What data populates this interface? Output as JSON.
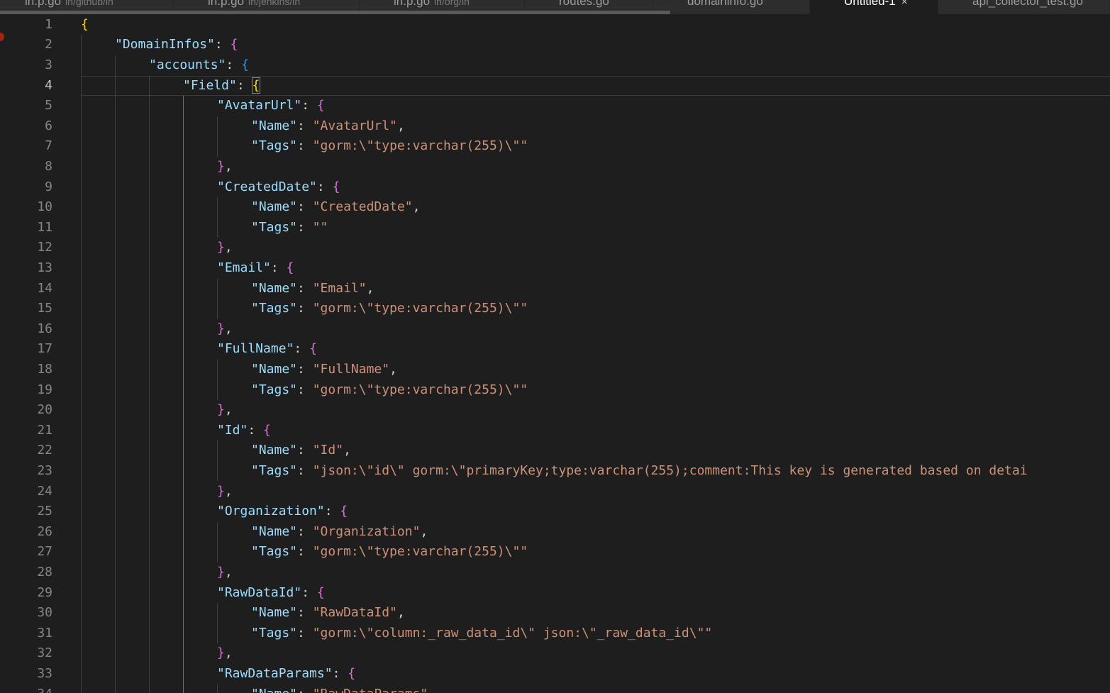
{
  "window": {
    "tabs": [
      {
        "name": "in.p.go",
        "path": "in/github/in",
        "active": false
      },
      {
        "name": "in.p.go",
        "path": "in/jenkins/in",
        "active": false
      },
      {
        "name": "in.p.go",
        "path": "in/org/in",
        "active": false
      },
      {
        "name": "routes.go",
        "path": "",
        "active": false
      },
      {
        "name": "domaininfo.go",
        "path": "",
        "active": false
      },
      {
        "name": "Untitled-1",
        "path": "",
        "active": true,
        "close": "×"
      },
      {
        "name": "api_collector_test.go",
        "path": "",
        "active": false
      }
    ]
  },
  "colors": {
    "background": "#1e1e1e",
    "key": "#9cdcfe",
    "string": "#ce9178",
    "bracket_level_1": "#ffd700",
    "bracket_level_2": "#da70d6",
    "bracket_level_3": "#179fff",
    "breakpoint": "#a1260d"
  },
  "editor": {
    "current_line": 4,
    "lines": [
      {
        "n": 1,
        "indent": 0,
        "tokens": [
          [
            "b1",
            "{"
          ]
        ]
      },
      {
        "n": 2,
        "indent": 1,
        "tokens": [
          [
            "t-key",
            "\"DomainInfos\""
          ],
          [
            "t-p",
            ": "
          ],
          [
            "b2",
            "{"
          ]
        ]
      },
      {
        "n": 3,
        "indent": 2,
        "tokens": [
          [
            "t-key",
            "\"accounts\""
          ],
          [
            "t-p",
            ": "
          ],
          [
            "b3",
            "{"
          ]
        ]
      },
      {
        "n": 4,
        "indent": 3,
        "tokens": [
          [
            "t-key",
            "\"Field\""
          ],
          [
            "t-p",
            ": "
          ],
          [
            "b1 bracket-match",
            "{"
          ]
        ]
      },
      {
        "n": 5,
        "indent": 4,
        "tokens": [
          [
            "t-key",
            "\"AvatarUrl\""
          ],
          [
            "t-p",
            ": "
          ],
          [
            "b2",
            "{"
          ]
        ]
      },
      {
        "n": 6,
        "indent": 5,
        "tokens": [
          [
            "t-key",
            "\"Name\""
          ],
          [
            "t-p",
            ": "
          ],
          [
            "t-str",
            "\"AvatarUrl\""
          ],
          [
            "t-p",
            ","
          ]
        ]
      },
      {
        "n": 7,
        "indent": 5,
        "tokens": [
          [
            "t-key",
            "\"Tags\""
          ],
          [
            "t-p",
            ": "
          ],
          [
            "t-str",
            "\"gorm:\\\"type:varchar(255)\\\"\""
          ]
        ]
      },
      {
        "n": 8,
        "indent": 4,
        "tokens": [
          [
            "b2",
            "}"
          ],
          [
            "t-p",
            ","
          ]
        ]
      },
      {
        "n": 9,
        "indent": 4,
        "tokens": [
          [
            "t-key",
            "\"CreatedDate\""
          ],
          [
            "t-p",
            ": "
          ],
          [
            "b2",
            "{"
          ]
        ]
      },
      {
        "n": 10,
        "indent": 5,
        "tokens": [
          [
            "t-key",
            "\"Name\""
          ],
          [
            "t-p",
            ": "
          ],
          [
            "t-str",
            "\"CreatedDate\""
          ],
          [
            "t-p",
            ","
          ]
        ]
      },
      {
        "n": 11,
        "indent": 5,
        "tokens": [
          [
            "t-key",
            "\"Tags\""
          ],
          [
            "t-p",
            ": "
          ],
          [
            "t-str",
            "\"\""
          ]
        ]
      },
      {
        "n": 12,
        "indent": 4,
        "tokens": [
          [
            "b2",
            "}"
          ],
          [
            "t-p",
            ","
          ]
        ]
      },
      {
        "n": 13,
        "indent": 4,
        "tokens": [
          [
            "t-key",
            "\"Email\""
          ],
          [
            "t-p",
            ": "
          ],
          [
            "b2",
            "{"
          ]
        ]
      },
      {
        "n": 14,
        "indent": 5,
        "tokens": [
          [
            "t-key",
            "\"Name\""
          ],
          [
            "t-p",
            ": "
          ],
          [
            "t-str",
            "\"Email\""
          ],
          [
            "t-p",
            ","
          ]
        ]
      },
      {
        "n": 15,
        "indent": 5,
        "tokens": [
          [
            "t-key",
            "\"Tags\""
          ],
          [
            "t-p",
            ": "
          ],
          [
            "t-str",
            "\"gorm:\\\"type:varchar(255)\\\"\""
          ]
        ]
      },
      {
        "n": 16,
        "indent": 4,
        "tokens": [
          [
            "b2",
            "}"
          ],
          [
            "t-p",
            ","
          ]
        ]
      },
      {
        "n": 17,
        "indent": 4,
        "tokens": [
          [
            "t-key",
            "\"FullName\""
          ],
          [
            "t-p",
            ": "
          ],
          [
            "b2",
            "{"
          ]
        ]
      },
      {
        "n": 18,
        "indent": 5,
        "tokens": [
          [
            "t-key",
            "\"Name\""
          ],
          [
            "t-p",
            ": "
          ],
          [
            "t-str",
            "\"FullName\""
          ],
          [
            "t-p",
            ","
          ]
        ]
      },
      {
        "n": 19,
        "indent": 5,
        "tokens": [
          [
            "t-key",
            "\"Tags\""
          ],
          [
            "t-p",
            ": "
          ],
          [
            "t-str",
            "\"gorm:\\\"type:varchar(255)\\\"\""
          ]
        ]
      },
      {
        "n": 20,
        "indent": 4,
        "tokens": [
          [
            "b2",
            "}"
          ],
          [
            "t-p",
            ","
          ]
        ]
      },
      {
        "n": 21,
        "indent": 4,
        "tokens": [
          [
            "t-key",
            "\"Id\""
          ],
          [
            "t-p",
            ": "
          ],
          [
            "b2",
            "{"
          ]
        ]
      },
      {
        "n": 22,
        "indent": 5,
        "tokens": [
          [
            "t-key",
            "\"Name\""
          ],
          [
            "t-p",
            ": "
          ],
          [
            "t-str",
            "\"Id\""
          ],
          [
            "t-p",
            ","
          ]
        ]
      },
      {
        "n": 23,
        "indent": 5,
        "tokens": [
          [
            "t-key",
            "\"Tags\""
          ],
          [
            "t-p",
            ": "
          ],
          [
            "t-str",
            "\"json:\\\"id\\\" gorm:\\\"primaryKey;type:varchar(255);comment:This key is generated based on detai"
          ]
        ]
      },
      {
        "n": 24,
        "indent": 4,
        "tokens": [
          [
            "b2",
            "}"
          ],
          [
            "t-p",
            ","
          ]
        ]
      },
      {
        "n": 25,
        "indent": 4,
        "tokens": [
          [
            "t-key",
            "\"Organization\""
          ],
          [
            "t-p",
            ": "
          ],
          [
            "b2",
            "{"
          ]
        ]
      },
      {
        "n": 26,
        "indent": 5,
        "tokens": [
          [
            "t-key",
            "\"Name\""
          ],
          [
            "t-p",
            ": "
          ],
          [
            "t-str",
            "\"Organization\""
          ],
          [
            "t-p",
            ","
          ]
        ]
      },
      {
        "n": 27,
        "indent": 5,
        "tokens": [
          [
            "t-key",
            "\"Tags\""
          ],
          [
            "t-p",
            ": "
          ],
          [
            "t-str",
            "\"gorm:\\\"type:varchar(255)\\\"\""
          ]
        ]
      },
      {
        "n": 28,
        "indent": 4,
        "tokens": [
          [
            "b2",
            "}"
          ],
          [
            "t-p",
            ","
          ]
        ]
      },
      {
        "n": 29,
        "indent": 4,
        "tokens": [
          [
            "t-key",
            "\"RawDataId\""
          ],
          [
            "t-p",
            ": "
          ],
          [
            "b2",
            "{"
          ]
        ]
      },
      {
        "n": 30,
        "indent": 5,
        "tokens": [
          [
            "t-key",
            "\"Name\""
          ],
          [
            "t-p",
            ": "
          ],
          [
            "t-str",
            "\"RawDataId\""
          ],
          [
            "t-p",
            ","
          ]
        ]
      },
      {
        "n": 31,
        "indent": 5,
        "tokens": [
          [
            "t-key",
            "\"Tags\""
          ],
          [
            "t-p",
            ": "
          ],
          [
            "t-str",
            "\"gorm:\\\"column:_raw_data_id\\\" json:\\\"_raw_data_id\\\"\""
          ]
        ]
      },
      {
        "n": 32,
        "indent": 4,
        "tokens": [
          [
            "b2",
            "}"
          ],
          [
            "t-p",
            ","
          ]
        ]
      },
      {
        "n": 33,
        "indent": 4,
        "tokens": [
          [
            "t-key",
            "\"RawDataParams\""
          ],
          [
            "t-p",
            ": "
          ],
          [
            "b2",
            "{"
          ]
        ]
      },
      {
        "n": 34,
        "indent": 5,
        "tokens": [
          [
            "t-key",
            "\"Name\""
          ],
          [
            "t-p",
            ": "
          ],
          [
            "t-str",
            "\"RawDataParams\""
          ],
          [
            "t-p",
            ","
          ]
        ]
      }
    ]
  }
}
